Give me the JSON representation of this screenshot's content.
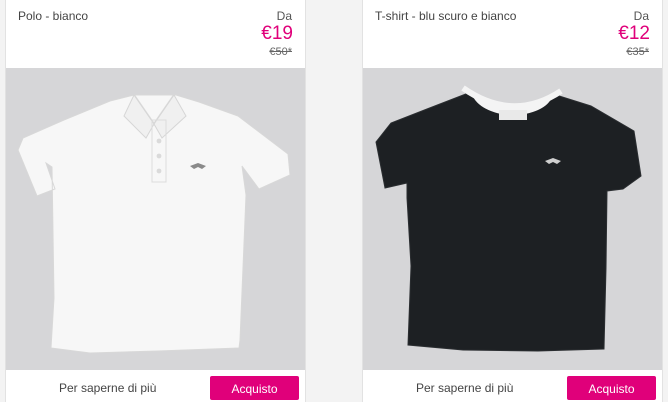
{
  "products": [
    {
      "name": "Polo - bianco",
      "from_label": "Da",
      "price": "€19",
      "old_price": "€50*",
      "more_label": "Per saperne di più",
      "buy_label": "Acquisto",
      "image": "white-polo-shirt"
    },
    {
      "name": "T-shirt - blu scuro e bianco",
      "from_label": "Da",
      "price": "€12",
      "old_price": "€35*",
      "more_label": "Per saperne di più",
      "buy_label": "Acquisto",
      "image": "navy-tshirt-white-collar"
    }
  ],
  "colors": {
    "accent": "#e0007a",
    "image_bg": "#d6d6d8"
  }
}
